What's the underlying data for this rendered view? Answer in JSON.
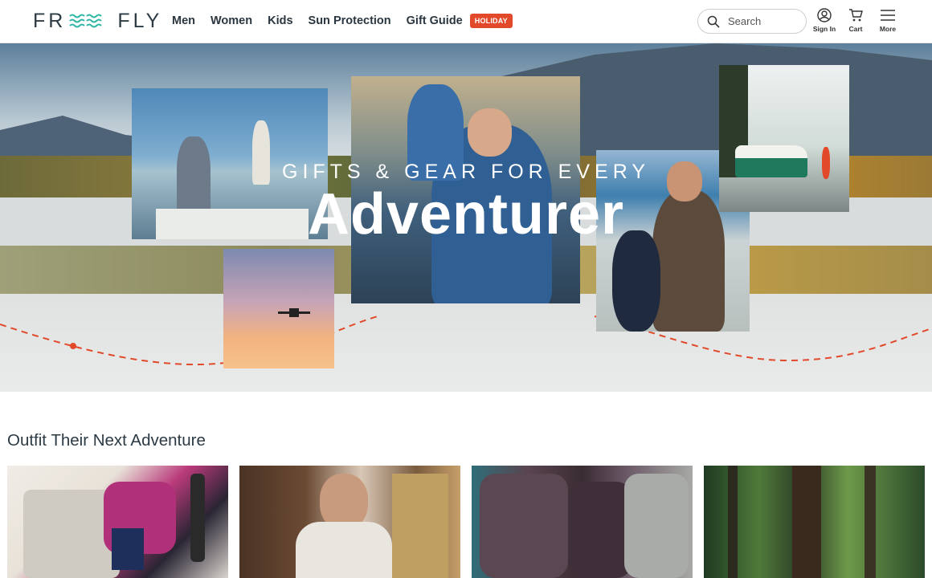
{
  "header": {
    "logo": {
      "left": "FR",
      "right": "FLY",
      "waves_icon": "waves-icon"
    },
    "nav": [
      {
        "label": "Men"
      },
      {
        "label": "Women"
      },
      {
        "label": "Kids"
      },
      {
        "label": "Sun Protection"
      },
      {
        "label": "Gift Guide"
      }
    ],
    "badge": "HOLIDAY",
    "search": {
      "placeholder": "Search",
      "icon": "search-icon"
    },
    "icons": [
      {
        "label": "Sign In",
        "icon": "user-icon"
      },
      {
        "label": "Cart",
        "icon": "cart-icon"
      },
      {
        "label": "More",
        "icon": "menu-icon"
      }
    ]
  },
  "hero": {
    "kicker": "GIFTS & GEAR FOR EVERY",
    "headline": "Adventurer",
    "accent_color": "#e2492b"
  },
  "section": {
    "title": "Outfit Their Next Adventure"
  },
  "colors": {
    "brand_text": "#2d3b45",
    "brand_accent": "#2bb6a3",
    "badge_bg": "#e2492b"
  }
}
